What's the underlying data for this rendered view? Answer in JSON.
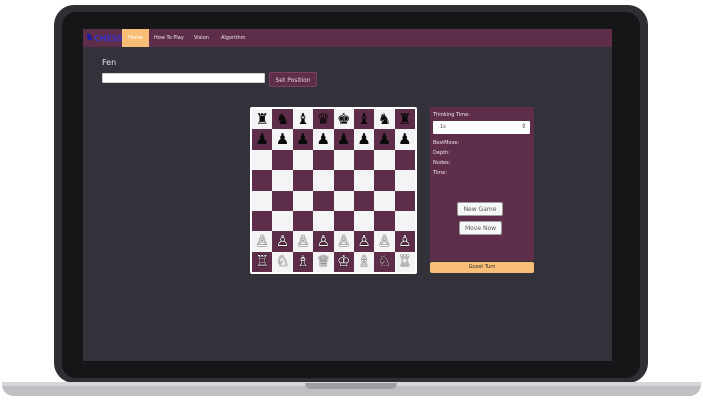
{
  "nav": {
    "logo_text": "CHESS",
    "items": [
      {
        "label": "Home",
        "active": true
      },
      {
        "label": "How To Play",
        "active": false
      },
      {
        "label": "Vision",
        "active": false
      },
      {
        "label": "Algorithm",
        "active": false
      }
    ]
  },
  "fen": {
    "label": "Fen",
    "value": "",
    "placeholder": "",
    "set_button": "Set Position"
  },
  "board": {
    "ranks": [
      [
        "♜",
        "♞",
        "♝",
        "♛",
        "♚",
        "♝",
        "♞",
        "♜"
      ],
      [
        "♟",
        "♟",
        "♟",
        "♟",
        "♟",
        "♟",
        "♟",
        "♟"
      ],
      [
        "",
        "",
        "",
        "",
        "",
        "",
        "",
        ""
      ],
      [
        "",
        "",
        "",
        "",
        "",
        "",
        "",
        ""
      ],
      [
        "",
        "",
        "",
        "",
        "",
        "",
        "",
        ""
      ],
      [
        "",
        "",
        "",
        "",
        "",
        "",
        "",
        ""
      ],
      [
        "♙",
        "♙",
        "♙",
        "♙",
        "♙",
        "♙",
        "♙",
        "♙"
      ],
      [
        "♖",
        "♘",
        "♗",
        "♕",
        "♔",
        "♗",
        "♘",
        "♖"
      ]
    ],
    "colors": {
      "light": "#f4f4f6",
      "dark": "#5e2d49"
    }
  },
  "panel": {
    "thinking_time_label": "Thinking Time:",
    "thinking_time_value": "1s",
    "bestmove_label": "BestMove:",
    "depth_label": "Depth:",
    "nodes_label": "Nodes:",
    "time_label": "Time:",
    "new_game_button": "New Game",
    "move_now_button": "Move Now",
    "turn_status": "Guest Turn"
  },
  "theme": {
    "accent": "#5e2d49",
    "highlight": "#f8be78",
    "background": "#33323a"
  }
}
